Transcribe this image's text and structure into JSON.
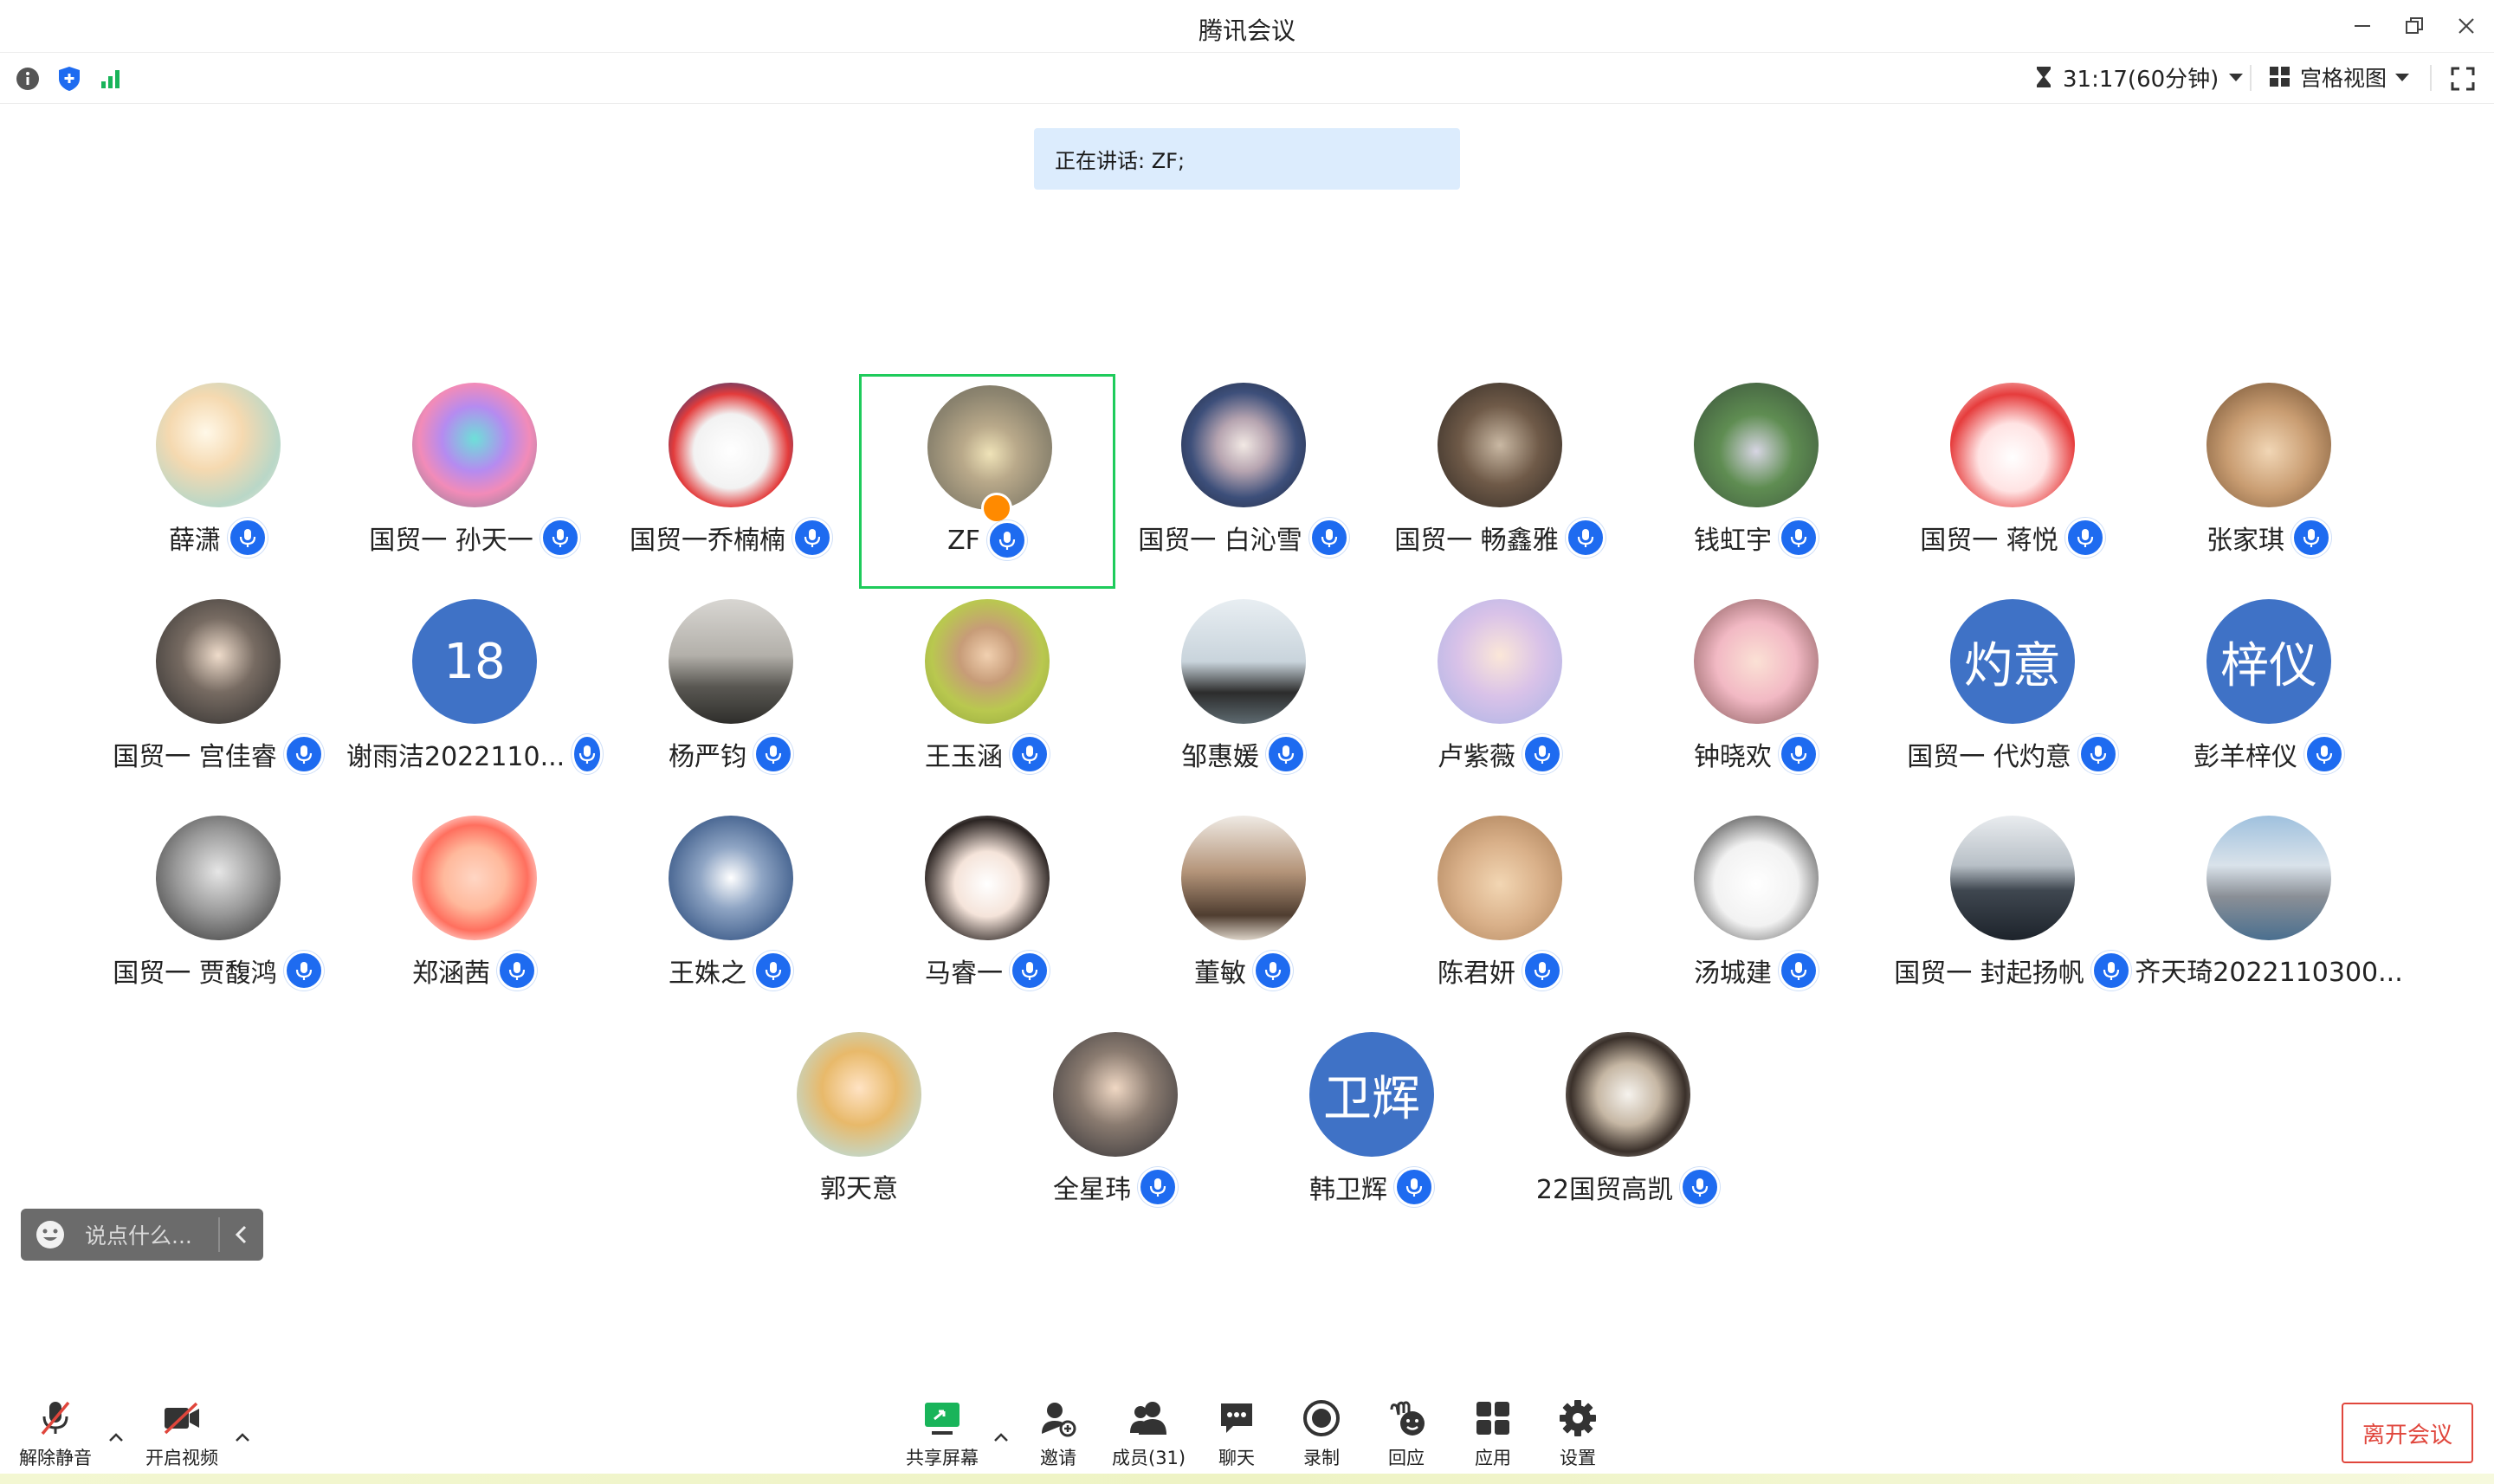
{
  "window": {
    "title": "腾讯会议"
  },
  "status": {
    "timer": "31:17(60分钟)",
    "view_label": "宫格视图"
  },
  "speaking": {
    "text": "正在讲话: ZF;"
  },
  "participants": [
    {
      "name": "薛潇",
      "mic": true,
      "avatar": "photo-flowers"
    },
    {
      "name": "国贸一 孙天一",
      "mic": true,
      "avatar": "photo-rainbow-gorilla"
    },
    {
      "name": "国贸一乔楠楠",
      "mic": true,
      "avatar": "photo-robot-cat"
    },
    {
      "name": "ZF",
      "mic": true,
      "avatar": "photo-duck",
      "active": true,
      "host": true
    },
    {
      "name": "国贸一 白沁雪",
      "mic": true,
      "avatar": "photo-woman-stage"
    },
    {
      "name": "国贸一 畅鑫雅",
      "mic": true,
      "avatar": "photo-reading-girl"
    },
    {
      "name": "钱虹宇",
      "mic": true,
      "avatar": "photo-girl-field"
    },
    {
      "name": "国贸一 蒋悦",
      "mic": true,
      "avatar": "photo-red-hair-cartoon"
    },
    {
      "name": "张家琪",
      "mic": true,
      "avatar": "photo-rabbit"
    },
    {
      "name": "国贸一 宫佳睿",
      "mic": true,
      "avatar": "photo-girl-street"
    },
    {
      "name": "谢雨洁2022110...",
      "mic": true,
      "avatar_text": "18"
    },
    {
      "name": "杨严钧",
      "mic": true,
      "avatar": "photo-person-road"
    },
    {
      "name": "王玉涵",
      "mic": true,
      "avatar": "photo-boy-green"
    },
    {
      "name": "邹惠媛",
      "mic": true,
      "avatar": "photo-girl-mountain"
    },
    {
      "name": "卢紫薇",
      "mic": true,
      "avatar": "photo-anime-boy"
    },
    {
      "name": "钟晓欢",
      "mic": true,
      "avatar": "photo-girl-pink"
    },
    {
      "name": "国贸一 代灼意",
      "mic": true,
      "avatar_text": "灼意"
    },
    {
      "name": "彭羊梓仪",
      "mic": true,
      "avatar_text": "梓仪"
    },
    {
      "name": "国贸一 贾馥鸿",
      "mic": true,
      "avatar": "photo-bw-boy"
    },
    {
      "name": "郑涵茜",
      "mic": true,
      "avatar": "photo-doll-girl"
    },
    {
      "name": "王姝之",
      "mic": true,
      "avatar": "photo-tom-cat"
    },
    {
      "name": "马睿一",
      "mic": true,
      "avatar": "photo-cartoon-girl"
    },
    {
      "name": "董敏",
      "mic": true,
      "avatar": "photo-bear-book"
    },
    {
      "name": "陈君妍",
      "mic": true,
      "avatar": "photo-teddy-bear"
    },
    {
      "name": "汤城建",
      "mic": true,
      "avatar": "photo-manga-sketch"
    },
    {
      "name": "国贸一 封起扬帆",
      "mic": true,
      "avatar": "photo-sea-city"
    },
    {
      "name": "齐天琦2022110300...",
      "mic": false,
      "avatar": "photo-snow-mountain"
    },
    {
      "name": "郭天意",
      "mic": false,
      "avatar": "photo-sunglasses-girl"
    },
    {
      "name": "全星玮",
      "mic": true,
      "avatar": "photo-man-portrait"
    },
    {
      "name": "韩卫辉",
      "mic": true,
      "avatar_text": "卫辉"
    },
    {
      "name": "22国贸高凯",
      "mic": true,
      "avatar": "photo-assassin-figure"
    }
  ],
  "chat": {
    "placeholder": "说点什么..."
  },
  "toolbar": {
    "unmute": "解除静音",
    "start_video": "开启视频",
    "share_screen": "共享屏幕",
    "invite": "邀请",
    "members": "成员(31)",
    "chat": "聊天",
    "record": "录制",
    "react": "回应",
    "apps": "应用",
    "settings": "设置",
    "leave": "离开会议"
  },
  "colors": {
    "accent": "#1e6bf0",
    "active_border": "#1ecb5b",
    "leave": "#e0463c",
    "text_avatar_bg": "#3f72c6",
    "banner_bg": "#dcecfd"
  }
}
